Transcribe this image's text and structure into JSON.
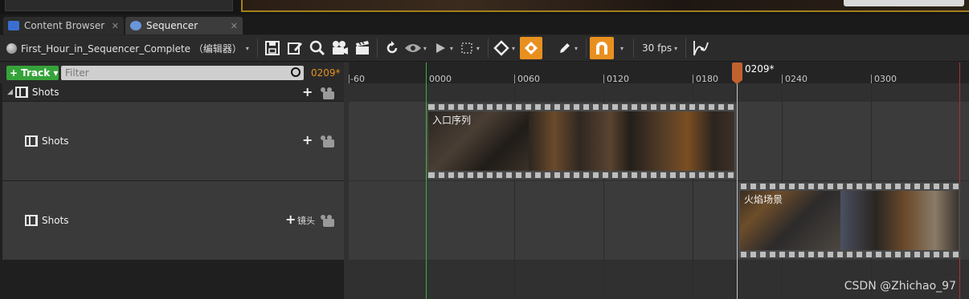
{
  "tabs": [
    {
      "label": "Content Browser",
      "close": "✕",
      "accent": "#3a6fd1"
    },
    {
      "label": "Sequencer",
      "close": "✕",
      "accent": "#6a95d8"
    }
  ],
  "toolbar": {
    "sequence_name": "First_Hour_in_Sequencer_Complete （编辑器）",
    "dropdown_arrow": "▾",
    "fps_label": "30 fps",
    "icons": [
      "save-icon",
      "edit-icon",
      "search-icon",
      "camera-icon",
      "clapper-icon",
      "refresh-icon",
      "eye-icon",
      "play-icon",
      "selection-icon",
      "key-icon",
      "auto-key-icon",
      "pencil-icon",
      "snap-magnet-icon",
      "curve-icon"
    ]
  },
  "left_panel": {
    "track_button": "+ Track ▾",
    "filter_placeholder": "Filter",
    "current_time": "0209*",
    "rows": [
      {
        "label": "Shots",
        "add": "+",
        "icon": "camera-icon"
      },
      {
        "label": "Shots",
        "add": "+",
        "icon": "camera-icon"
      },
      {
        "label": "Shots",
        "add": "+",
        "add_label": "镜头",
        "icon": "camera-icon"
      }
    ]
  },
  "timeline": {
    "ruler_labels": [
      "-60",
      "0000",
      "0060",
      "0120",
      "0180",
      "0240",
      "0300"
    ],
    "playhead_label": "0209*",
    "shots": [
      {
        "label": "入口序列"
      },
      {
        "label": "火焰场景"
      }
    ],
    "colors": {
      "playhead": "#c0622f",
      "start": "#3bb33b",
      "end": "#b43030",
      "accent": "#e8901f"
    }
  },
  "watermark": "CSDN @Zhichao_97"
}
